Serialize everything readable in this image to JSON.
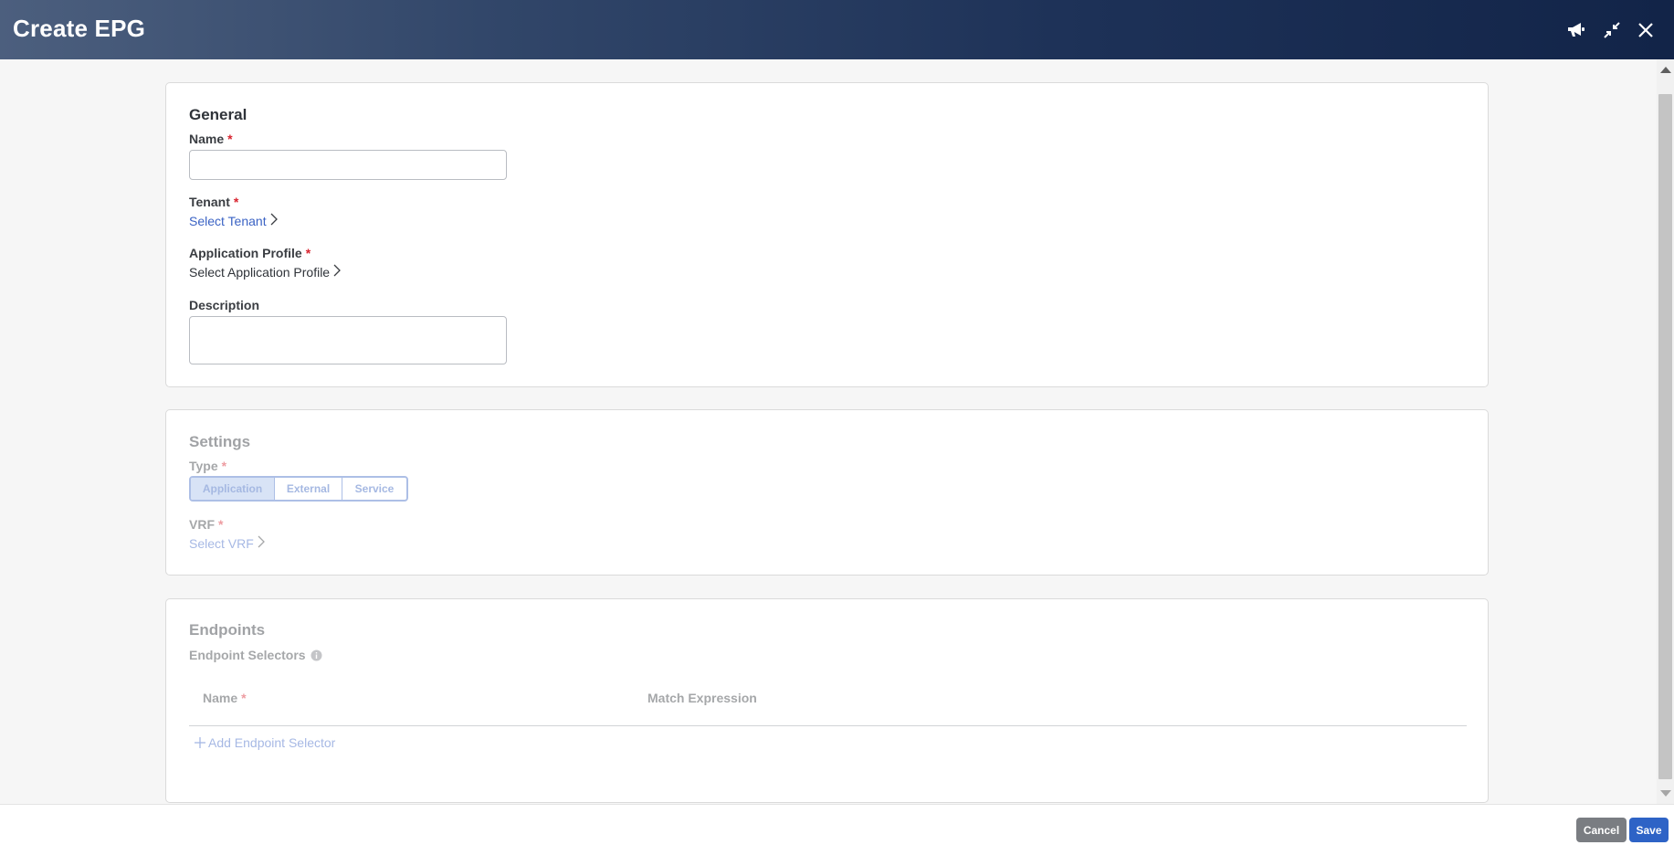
{
  "window": {
    "title": "Create EPG",
    "icons": [
      "megaphone-icon",
      "minimize-icon",
      "close-icon"
    ]
  },
  "general": {
    "heading": "General",
    "name_label": "Name",
    "required_mark": "*",
    "name_value": "",
    "tenant_label": "Tenant",
    "tenant_link": "Select Tenant",
    "app_profile_label": "Application Profile",
    "app_profile_link": "Select Application Profile",
    "description_label": "Description",
    "description_value": ""
  },
  "settings": {
    "heading": "Settings",
    "type_label": "Type",
    "type_options": [
      "Application",
      "External",
      "Service"
    ],
    "type_selected": "Application",
    "vrf_label": "VRF",
    "vrf_link": "Select VRF"
  },
  "endpoints": {
    "heading": "Endpoints",
    "selectors_label": "Endpoint Selectors",
    "columns": [
      "Name",
      "Match Expression"
    ],
    "add_link": "Add Endpoint Selector"
  },
  "footer": {
    "cancel_label": "Cancel",
    "save_label": "Save"
  },
  "colors": {
    "header_start": "#4c5f7e",
    "header_end": "#122448",
    "link": "#3b63c4",
    "required": "#d8242f",
    "save": "#2e63c6",
    "cancel": "#7a7d82"
  }
}
